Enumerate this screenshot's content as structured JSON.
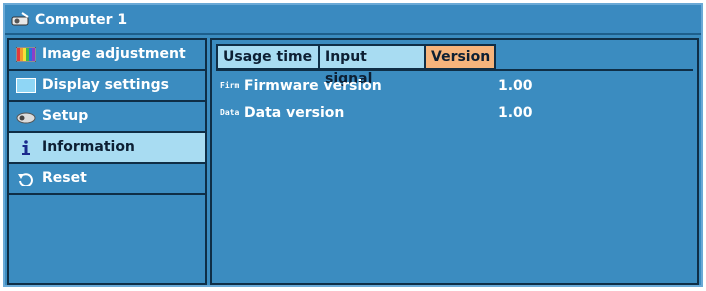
{
  "window": {
    "title": "Computer 1",
    "title_icon": "projector-icon"
  },
  "sidebar": {
    "items": [
      {
        "label": "Image adjustment",
        "icon": "color-palette-icon"
      },
      {
        "label": "Display settings",
        "icon": "display-screen-icon"
      },
      {
        "label": "Setup",
        "icon": "projector-setup-icon"
      },
      {
        "label": "Information",
        "icon": "info-icon"
      },
      {
        "label": "Reset",
        "icon": "reset-arrow-icon"
      }
    ],
    "active_index": 3
  },
  "tabs": [
    {
      "label": "Usage time"
    },
    {
      "label": "Input signal"
    },
    {
      "label": "Version"
    }
  ],
  "active_tab_index": 2,
  "version_info": [
    {
      "badge": "Firm",
      "label": "Firmware version",
      "value": "1.00"
    },
    {
      "badge": "Data",
      "label": "Data version",
      "value": "1.00"
    }
  ],
  "colors": {
    "panel_blue": "#3b8cc0",
    "highlight_light_blue": "#a8dcf2",
    "active_tab_orange": "#f6b47c",
    "border_dark": "#0f2e46"
  }
}
